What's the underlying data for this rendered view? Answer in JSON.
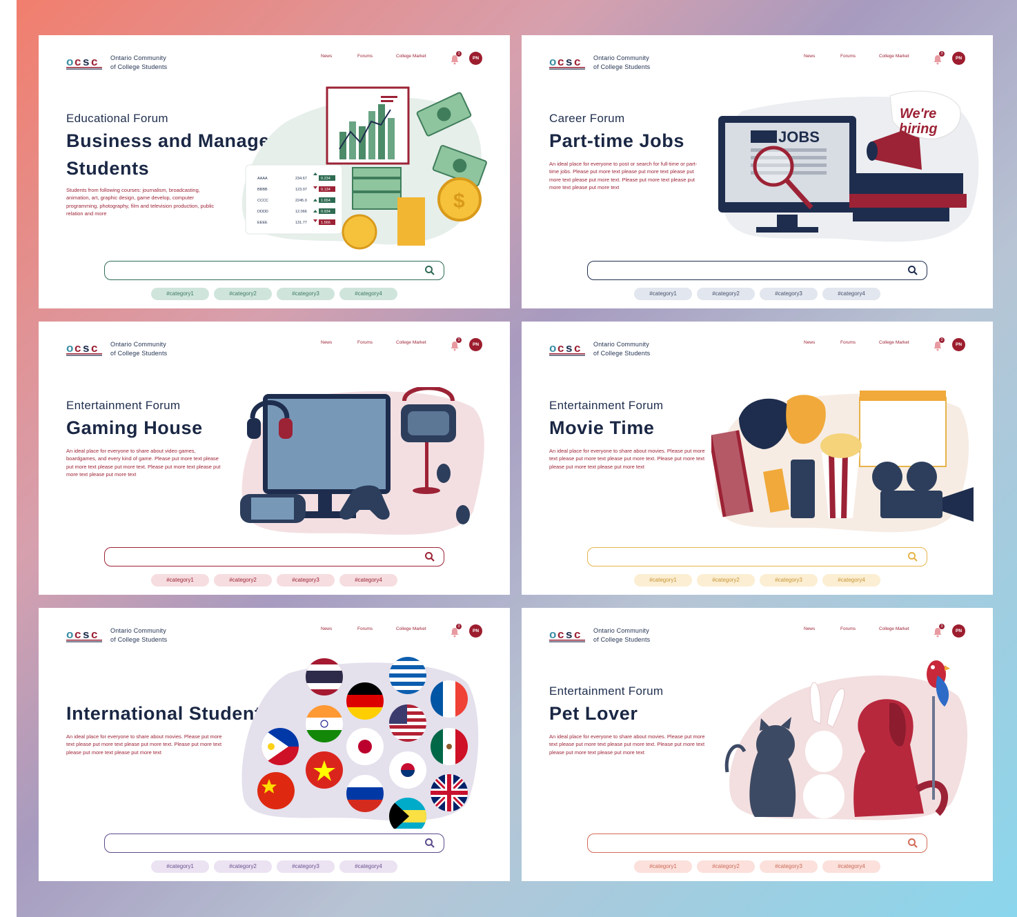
{
  "site": {
    "logo_text": "OCSC",
    "org_line1": "Ontario Community",
    "org_line2": "of College Students",
    "nav": [
      "News",
      "Forums",
      "College Market"
    ],
    "notification_count": "3",
    "avatar_initials": "PN"
  },
  "cards": [
    {
      "eyebrow": "Educational Forum",
      "title_line1": "Business and Management",
      "title_line2": "Students",
      "description": "Students from following courses: journalism, broadcasting, animation, art, graphic design, game develop, computer programming, photography, film and television production, public relation and more",
      "accent": "#2e6b52",
      "chip_bg": "#cfe5dc",
      "chip_text": "#3e7a63",
      "tags": [
        "#category1",
        "#category2",
        "#category3",
        "#category4"
      ],
      "stocks": [
        {
          "sym": "AAAA",
          "price": "234.67",
          "dir": "up",
          "chg": "0.234"
        },
        {
          "sym": "BBBB",
          "price": "123.07",
          "dir": "down",
          "chg": "0.134"
        },
        {
          "sym": "CCCC",
          "price": "2245.0",
          "dir": "up",
          "chg": "1.654"
        },
        {
          "sym": "DDDD",
          "price": "12.066",
          "dir": "up",
          "chg": "0.934"
        },
        {
          "sym": "EEEE",
          "price": "131.77",
          "dir": "down",
          "chg": "1.566"
        }
      ]
    },
    {
      "eyebrow": "Career Forum",
      "title_line1": "Part-time Jobs",
      "title_line2": "",
      "description": "An ideal place for everyone to post or search for full-time or part-time jobs. Please put more text please put more text please put more text please put more text. Please put more text please put more text please put more text",
      "accent": "#1e2d4d",
      "chip_bg": "#e2e6ee",
      "chip_text": "#45506a",
      "tags": [
        "#category1",
        "#category2",
        "#category3",
        "#category4"
      ],
      "screen_label": "JOBS",
      "bubble_line1": "We're",
      "bubble_line2": "hiring"
    },
    {
      "eyebrow": "Entertainment Forum",
      "title_line1": "Gaming House",
      "title_line2": "",
      "description": "An ideal place for everyone to share about video games, boardgames, and every kind of game. Please put more text please put more text please put more text. Please put more text please put more text please put more text",
      "accent": "#9c2235",
      "chip_bg": "#f6dde0",
      "chip_text": "#9c2235",
      "tags": [
        "#category1",
        "#category2",
        "#category3",
        "#category4"
      ]
    },
    {
      "eyebrow": "Entertainment Forum",
      "title_line1": "Movie Time",
      "title_line2": "",
      "description": "An ideal place for everyone to share about movies. Please put more text please put more text please put more text. Please put more text please put more text please put more text",
      "accent": "#e6b34a",
      "chip_bg": "#fbeed2",
      "chip_text": "#c89433",
      "tags": [
        "#category1",
        "#category2",
        "#category3",
        "#category4"
      ]
    },
    {
      "eyebrow": "",
      "title_line1": "International Students",
      "title_line2": "",
      "description": "An ideal place for everyone to share about movies. Please put more text please put more text please put more text. Please put more text please put more text please put more text",
      "accent": "#5a4a8c",
      "chip_bg": "#ebe2f2",
      "chip_text": "#6a4f8f",
      "tags": [
        "#category1",
        "#category2",
        "#category3",
        "#category4"
      ]
    },
    {
      "eyebrow": "Entertainment Forum",
      "title_line1": "Pet Lover",
      "title_line2": "",
      "description": "An ideal place for everyone to share about movies. Please put more text please put more text please put more text. Please put more text please put more text please put more text",
      "accent": "#d36a55",
      "chip_bg": "#fbe0db",
      "chip_text": "#cc6a58",
      "tags": [
        "#category1",
        "#category2",
        "#category3",
        "#category4"
      ]
    }
  ]
}
